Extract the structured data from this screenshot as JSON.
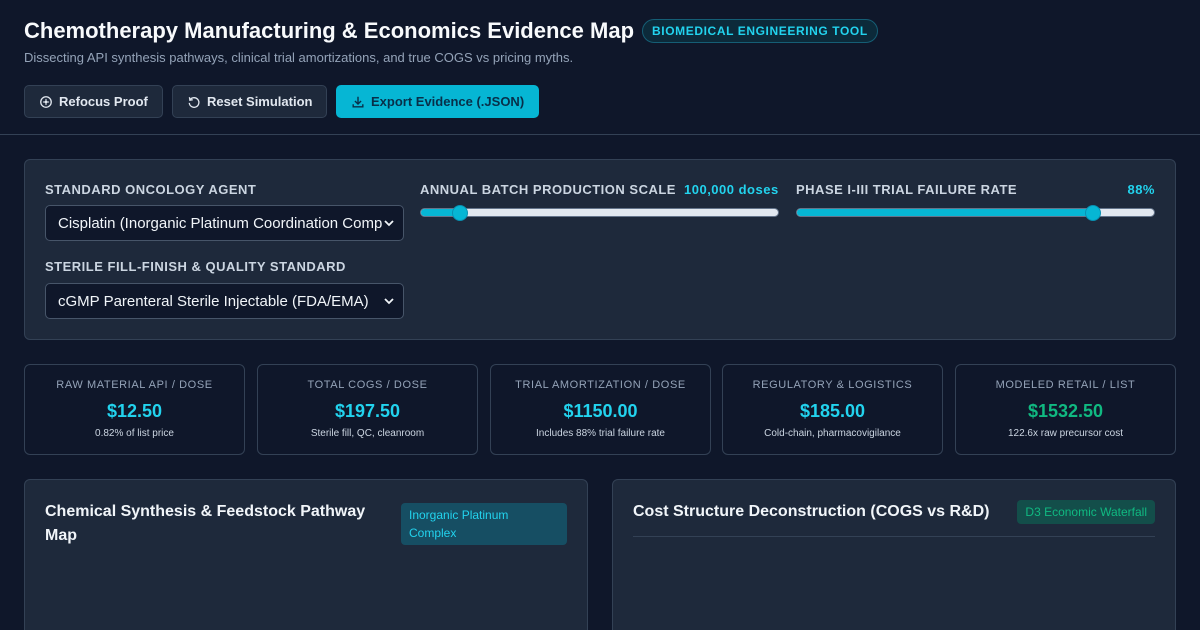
{
  "header": {
    "title": "Chemotherapy Manufacturing & Economics Evidence Map",
    "badge": "BIOMEDICAL ENGINEERING TOOL",
    "subtitle": "Dissecting API synthesis pathways, clinical trial amortizations, and true COGS vs pricing myths."
  },
  "toolbar": {
    "refocus_label": "Refocus Proof",
    "reset_label": "Reset Simulation",
    "export_label": "Export Evidence (.JSON)"
  },
  "controls": {
    "agent_label": "STANDARD ONCOLOGY AGENT",
    "agent_value": "Cisplatin (Inorganic Platinum Coordination Complex)",
    "fill_label": "STERILE FILL-FINISH & QUALITY STANDARD",
    "fill_value": "cGMP Parenteral Sterile Injectable (FDA/EMA)",
    "batch_label": "ANNUAL BATCH PRODUCTION SCALE",
    "batch_value": "100,000 doses",
    "batch_fraction": 0.11,
    "failure_label": "PHASE I-III TRIAL FAILURE RATE",
    "failure_value": "88%",
    "failure_fraction": 0.83
  },
  "metrics": [
    {
      "label": "RAW MATERIAL API / DOSE",
      "value": "$12.50",
      "note": "0.82% of list price"
    },
    {
      "label": "TOTAL COGS / DOSE",
      "value": "$197.50",
      "note": "Sterile fill, QC, cleanroom"
    },
    {
      "label": "TRIAL AMORTIZATION / DOSE",
      "value": "$1150.00",
      "note": "Includes 88% trial failure rate"
    },
    {
      "label": "REGULATORY & LOGISTICS",
      "value": "$185.00",
      "note": "Cold-chain, pharmacovigilance"
    },
    {
      "label": "MODELED RETAIL / LIST",
      "value": "$1532.50",
      "note": "122.6x raw precursor cost"
    }
  ],
  "panels": {
    "synthesis_title": "Chemical Synthesis & Feedstock Pathway Map",
    "synthesis_tag": "Inorganic Platinum Complex",
    "cost_title": "Cost Structure Deconstruction (COGS vs R&D)",
    "cost_tag": "D3 Economic Waterfall"
  },
  "colors": {
    "background": "#0f172a",
    "panel": "#1e293b",
    "accent": "#06b6d4",
    "accent_text": "#22d3ee",
    "positive": "#10b981"
  }
}
